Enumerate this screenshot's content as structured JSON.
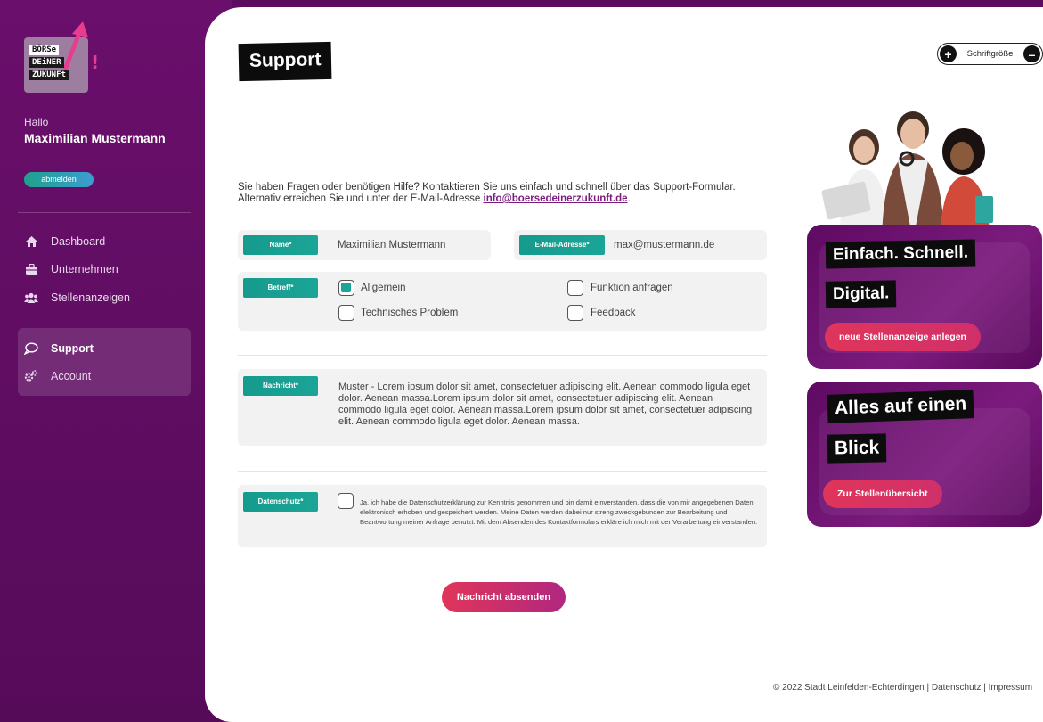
{
  "sidebar": {
    "logo": {
      "line1": "BÖRSe",
      "line2": "DEiNER",
      "line3": "ZUKUNFt"
    },
    "greeting": "Hallo",
    "user_name": "Maximilian Mustermann",
    "logout_label": "abmelden",
    "nav": [
      {
        "label": "Dashboard",
        "icon": "home-icon"
      },
      {
        "label": "Unternehmen",
        "icon": "briefcase-icon"
      },
      {
        "label": "Stellenanzeigen",
        "icon": "users-icon"
      },
      {
        "label": "Support",
        "icon": "chat-bubble-icon",
        "active": true
      },
      {
        "label": "Account",
        "icon": "gears-icon"
      }
    ]
  },
  "header": {
    "title": "Support",
    "font_size_label": "Schriftgröße"
  },
  "intro": {
    "text": "Sie haben Fragen oder benötigen Hilfe? Kontaktieren Sie uns einfach und schnell über das Support-Formular. Alternativ erreichen Sie und unter der E-Mail-Adresse ",
    "email_link": "info@boersedeinerzukunft.de",
    "end": "."
  },
  "form": {
    "name_label": "Name*",
    "name_value": "Maximilian Mustermann",
    "email_label": "E-Mail-Adresse*",
    "email_value": "max@mustermann.de",
    "subject_label": "Betreff*",
    "subjects": [
      {
        "label": "Allgemein",
        "checked": true
      },
      {
        "label": "Technisches Problem",
        "checked": false
      },
      {
        "label": "Funktion anfragen",
        "checked": false
      },
      {
        "label": "Feedback",
        "checked": false
      }
    ],
    "message_label": "Nachricht*",
    "message_value": "Muster - Lorem ipsum dolor sit amet, consectetuer adipiscing elit. Aenean commodo ligula eget dolor. Aenean massa.Lorem ipsum dolor sit amet, consectetuer adipiscing elit. Aenean commodo ligula eget dolor. Aenean massa.Lorem ipsum dolor sit amet, consectetuer adipiscing elit. Aenean commodo ligula eget dolor. Aenean massa.",
    "privacy_label": "Datenschutz*",
    "privacy_text": "Ja, ich habe die Datenschutzerklärung zur Kenntnis genommen und bin damit einverstanden, dass die von mir angegebenen Daten elektronisch erhoben und gespeichert werden. Meine Daten werden dabei nur streng zweckgebunden zur Bearbeitung und Beantwortung meiner Anfrage benutzt. Mit dem Absenden des Kontaktformulars erkläre ich mich mit der Verarbeitung einverstanden.",
    "privacy_checked": false,
    "submit_label": "Nachricht absenden"
  },
  "promo": {
    "card1_line1": "Einfach. Schnell.",
    "card1_line2": "Digital.",
    "card1_button": "neue Stellenanzeige anlegen",
    "card2_line1": "Alles auf einen",
    "card2_line2": "Blick",
    "card2_button": "Zur Stellenübersicht"
  },
  "footer": {
    "copyright": "© 2022 Stadt Leinfelden-Echterdingen",
    "privacy_link": "Datenschutz",
    "imprint_link": "Impressum"
  },
  "colors": {
    "sidebar_bg": "#5e0c61",
    "accent_teal": "#1ba597",
    "accent_red": "#e0355a",
    "title_bg": "#0c0c0c"
  }
}
